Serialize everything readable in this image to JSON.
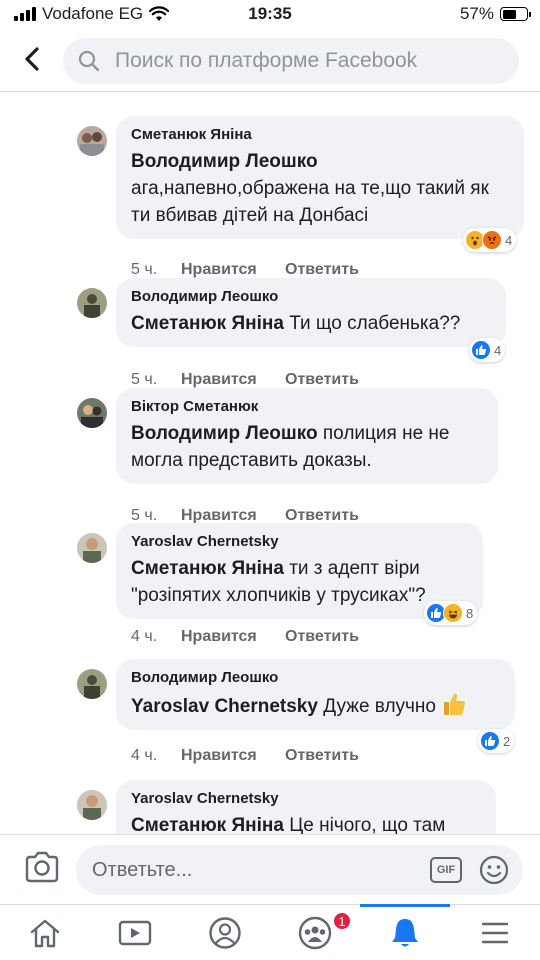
{
  "status": {
    "carrier": "Vodafone EG",
    "time": "19:35",
    "battery": "57%",
    "battery_level": 0.57
  },
  "search": {
    "placeholder": "Поиск по платформе Facebook"
  },
  "comments": [
    {
      "author": "Сметанюк Яніна",
      "mention": "Володимир Леошко",
      "text": "ага,напевно,ображена на те,що такий як ти вбивав дітей на Донбасі",
      "time": "5 ч.",
      "like": "Нравится",
      "reply": "Ответить",
      "reactions": [
        "wow",
        "angry"
      ],
      "reaction_count": "4"
    },
    {
      "author": "Володимир Леошко",
      "mention": "Сметанюк Яніна",
      "text": "Ти що слабенька??",
      "time": "5 ч.",
      "like": "Нравится",
      "reply": "Ответить",
      "reactions": [
        "like"
      ],
      "reaction_count": "4"
    },
    {
      "author": "Віктор Сметанюк",
      "mention": "Володимир Леошко",
      "text": "полиция не не могла представить доказы.",
      "time": "5 ч.",
      "like": "Нравится",
      "reply": "Ответить",
      "reactions": [],
      "reaction_count": ""
    },
    {
      "author": "Yaroslav Chernetsky",
      "mention": "Сметанюк Яніна",
      "text": "ти з адепт віри \"розіпятих хлопчиків у трусиках\"?",
      "time": "4 ч.",
      "like": "Нравится",
      "reply": "Ответить",
      "reactions": [
        "like",
        "haha"
      ],
      "reaction_count": "8"
    },
    {
      "author": "Володимир Леошко",
      "mention": "Yaroslav Chernetsky",
      "text": "Дуже влучно",
      "time": "4 ч.",
      "like": "Нравится",
      "reply": "Ответить",
      "reactions": [
        "like"
      ],
      "reaction_count": "2"
    },
    {
      "author": "Yaroslav Chernetsky",
      "mention": "Сметанюк Яніна",
      "text": "Це нічого, що там",
      "time": "",
      "like": "",
      "reply": "",
      "reactions": [],
      "reaction_count": ""
    }
  ],
  "composer": {
    "placeholder": "Ответьте...",
    "gif_label": "GIF"
  },
  "tabbar": {
    "notification_count": "1"
  },
  "colors": {
    "accent": "#1877f2",
    "bubble": "#f0f2f5",
    "badge": "#e41e3f"
  }
}
